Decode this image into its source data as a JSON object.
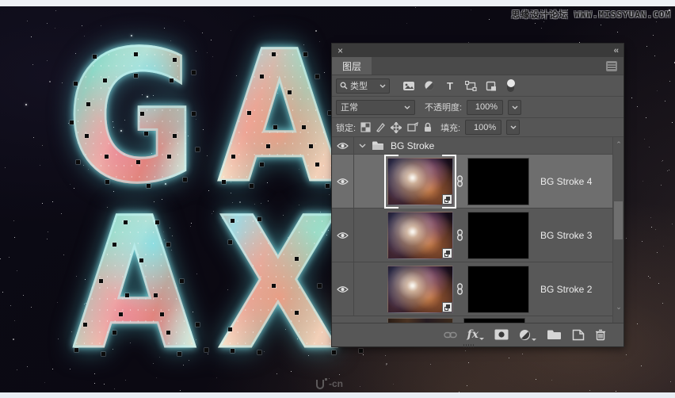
{
  "watermarks": {
    "top": "思缘设计论坛 WWW.MISSYUAN.COM",
    "bottom_logo": "Ui",
    "bottom_text": "-cn"
  },
  "canvas": {
    "lines": {
      "line1": "GA",
      "line2": "AX"
    }
  },
  "panel": {
    "close_glyph": "×",
    "collapse_glyph": "‹‹",
    "tab": "图层",
    "filter": {
      "search_label": "类型",
      "icons": [
        "pixel-filter-icon",
        "adjustment-filter-icon",
        "type-filter-icon",
        "shape-filter-icon",
        "smart-object-filter-icon"
      ],
      "toggle": "filter-toggle"
    },
    "blend": {
      "mode": "正常",
      "opacity_label": "不透明度:",
      "opacity_value": "100%"
    },
    "lock": {
      "label": "锁定:",
      "icons": [
        "lock-transparency-icon",
        "lock-paint-icon",
        "lock-move-icon",
        "lock-artboard-icon",
        "lock-all-icon"
      ],
      "fill_label": "填充:",
      "fill_value": "100%"
    },
    "group": {
      "name": "BG Stroke"
    },
    "layers": [
      {
        "name": "BG Stroke 4",
        "selected": true
      },
      {
        "name": "BG Stroke 3",
        "selected": false
      },
      {
        "name": "BG Stroke 2",
        "selected": false
      }
    ],
    "toolbar_icons": [
      "link-icon",
      "layer-style-icon",
      "layer-mask-icon",
      "adjustment-icon",
      "new-group-icon",
      "new-layer-icon",
      "delete-icon"
    ],
    "scrollbar": {
      "up": "⌃",
      "down": "⌄"
    }
  },
  "colors": {
    "panel_bg": "#565656",
    "selected_row": "#6e6e6e",
    "titlebar": "#3a3a3a",
    "glow_accent": "#7fe0e8",
    "strip": "#eef1f5"
  }
}
